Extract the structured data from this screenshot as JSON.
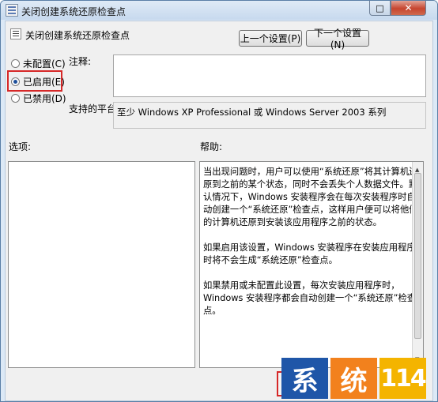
{
  "window": {
    "title": "关闭创建系统还原检查点",
    "max_glyph": "□",
    "close_glyph": "✕"
  },
  "header": {
    "title": "关闭创建系统还原检查点",
    "prev_button": "上一个设置(P)",
    "next_button": "下一个设置(N)"
  },
  "state": {
    "options": [
      {
        "label": "未配置(C)",
        "checked": false
      },
      {
        "label": "已启用(E)",
        "checked": true
      },
      {
        "label": "已禁用(D)",
        "checked": false
      }
    ]
  },
  "comment": {
    "label": "注释:",
    "value": ""
  },
  "platform": {
    "label": "支持的平台:",
    "value": "至少 Windows XP Professional 或 Windows Server 2003 系列"
  },
  "options_label": "选项:",
  "help": {
    "label": "帮助:",
    "paragraphs": [
      "当出现问题时，用户可以使用“系统还原”将其计算机还原到之前的某个状态，同时不会丢失个人数据文件。默认情况下，Windows 安装程序会在每次安装程序时自动创建一个“系统还原”检查点，这样用户便可以将他们的计算机还原到安装该应用程序之前的状态。",
      "如果启用该设置，Windows 安装程序在安装应用程序时将不会生成“系统还原”检查点。",
      "如果禁用或未配置此设置，每次安装应用程序时，Windows 安装程序都会自动创建一个“系统还原”检查点。"
    ]
  },
  "watermark": {
    "chars": [
      "系",
      "统",
      "114"
    ],
    "colors": [
      "#1f56a8",
      "#f2811d",
      "#f4b400"
    ]
  }
}
